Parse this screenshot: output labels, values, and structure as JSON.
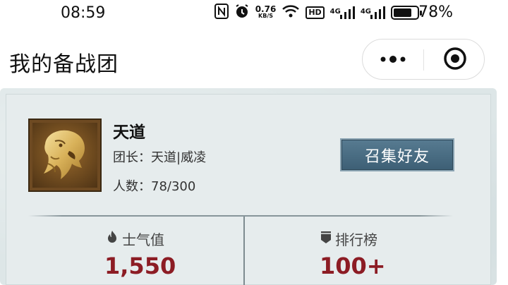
{
  "status_bar": {
    "time": "08:59",
    "net_speed_value": "0.76",
    "net_speed_unit": "KB/S",
    "hd_label": "HD",
    "signal_label_1": "4G",
    "signal_label_2": "4G",
    "battery_percent": "78%",
    "battery_level": 0.78
  },
  "header": {
    "title": "我的备战团"
  },
  "team": {
    "name": "天道",
    "leader_line": "团长：天道|威凌",
    "members_line": "人数：78/300",
    "summon_button_label": "召集好友"
  },
  "stats": {
    "morale_label": "士气值",
    "morale_value": "1,550",
    "rank_label": "排行榜",
    "rank_value": "100+"
  },
  "colors": {
    "accent_value": "#8c1c24",
    "button_bg": "#4a6b80",
    "card_bg": "#e6eced"
  },
  "icons": {
    "more": "more-dots-icon",
    "close": "target-close-icon",
    "morale": "flame-icon",
    "rank": "shield-icon",
    "emblem": "tiger-emblem"
  }
}
